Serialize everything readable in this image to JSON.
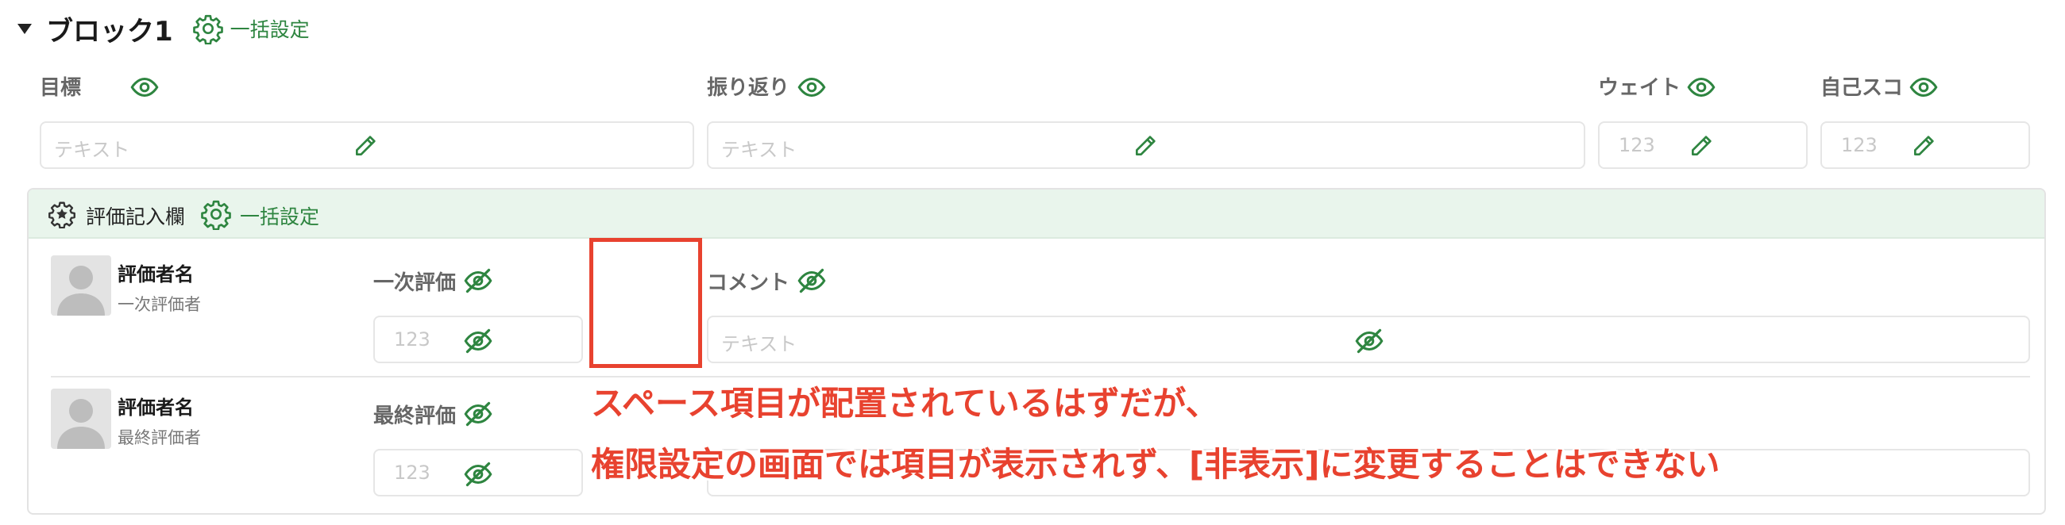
{
  "block": {
    "title": "ブロック1",
    "bulk_label": "一括設定"
  },
  "columns": [
    {
      "label": "目標",
      "placeholder": "テキスト"
    },
    {
      "label": "振り返り",
      "placeholder": "テキスト"
    },
    {
      "label": "ウェイト",
      "placeholder": "123"
    },
    {
      "label": "自己スコ",
      "placeholder": "123"
    }
  ],
  "eval_section": {
    "title": "評価記入欄",
    "bulk_label": "一括設定",
    "rows": [
      {
        "name": "評価者名",
        "role": "一次評価者",
        "score_label": "一次評価",
        "score_placeholder": "123",
        "comment_label": "コメント",
        "comment_placeholder": "テキスト"
      },
      {
        "name": "評価者名",
        "role": "最終評価者",
        "score_label": "最終評価",
        "score_placeholder": "123"
      }
    ]
  },
  "annotation": {
    "line1": "スペース項目が配置されているはずだが、",
    "line2": "権限設定の画面では項目が表示されず、[非表示]に変更することはできない"
  },
  "colors": {
    "accent_green": "#2e8540",
    "header_bg": "#e9f5ec",
    "annotation_red": "#e8422f"
  },
  "icons": {
    "collapse": "caret-down-icon",
    "settings": "gear-icon",
    "visible": "eye-icon",
    "hidden": "eye-slash-icon",
    "edit": "pencil-icon",
    "evaluation": "star-badge-icon",
    "avatar": "user-avatar-icon"
  }
}
